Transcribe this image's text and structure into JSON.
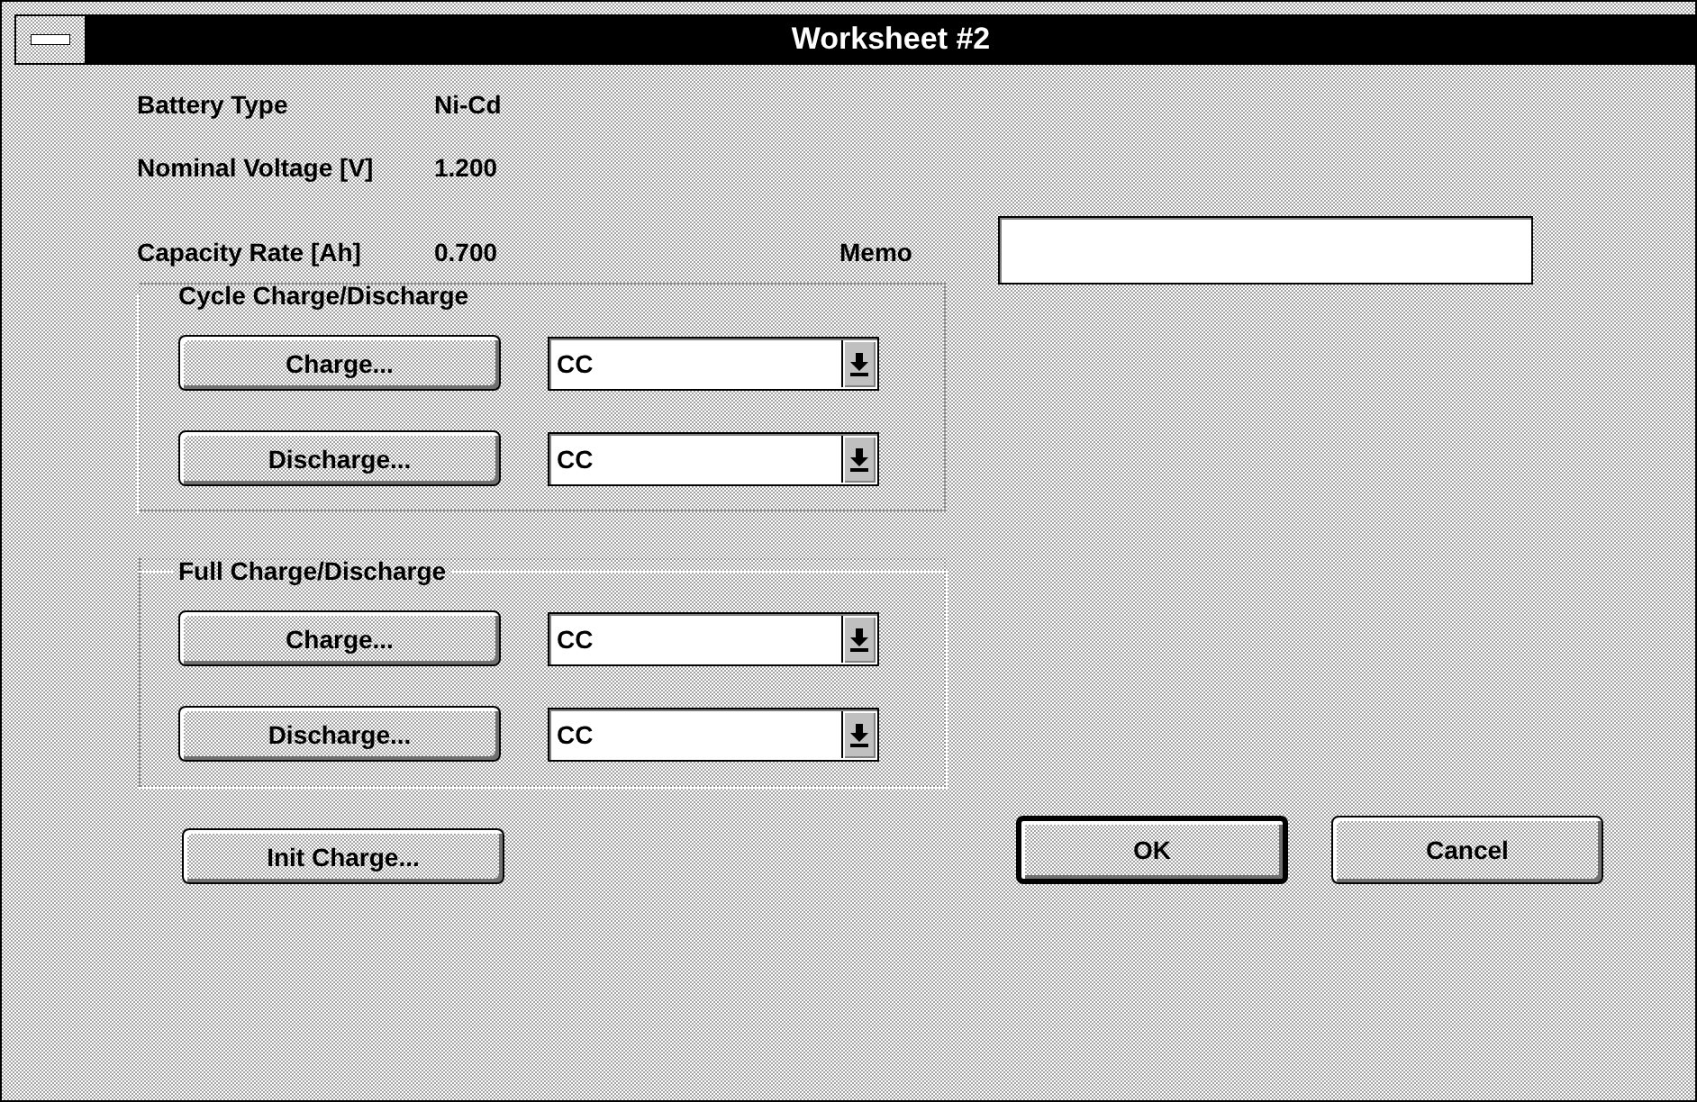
{
  "window": {
    "title": "Worksheet #2"
  },
  "info": [
    {
      "label": "Battery Type",
      "value": "Ni-Cd"
    },
    {
      "label": "Nominal Voltage [V]",
      "value": "1.200"
    },
    {
      "label": "Capacity Rate [Ah]",
      "value": "0.700"
    }
  ],
  "memo": {
    "label": "Memo"
  },
  "groups": [
    {
      "title": "Cycle Charge/Discharge",
      "rows": [
        {
          "button": "Charge...",
          "mode": "CC"
        },
        {
          "button": "Discharge...",
          "mode": "CC"
        }
      ]
    },
    {
      "title": "Full Charge/Discharge",
      "rows": [
        {
          "button": "Charge...",
          "mode": "CC"
        },
        {
          "button": "Discharge...",
          "mode": "CC"
        }
      ]
    }
  ],
  "init_button": {
    "label": "Init Charge..."
  },
  "dialog_buttons": [
    {
      "label": "OK",
      "default": true
    },
    {
      "label": "Cancel",
      "default": false
    }
  ]
}
